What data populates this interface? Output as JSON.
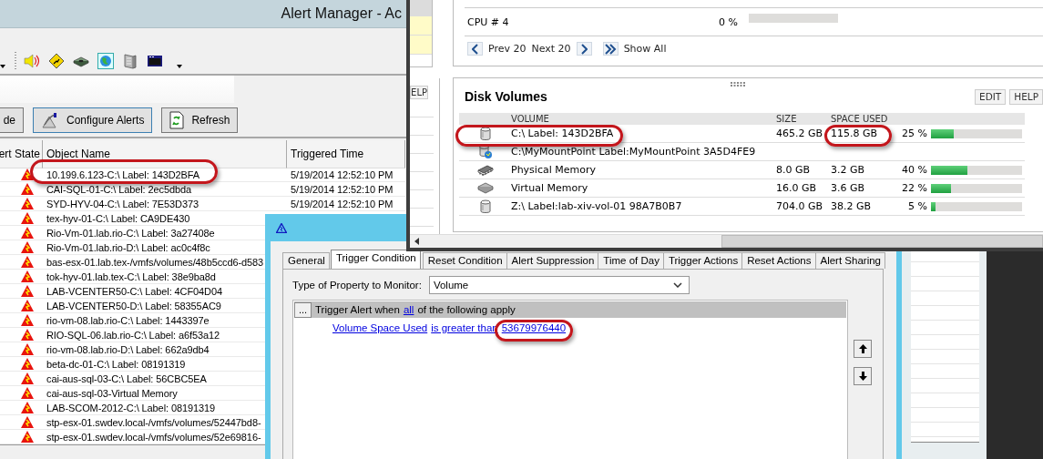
{
  "alert_manager": {
    "title": "Alert Manager - Ac",
    "buttons": [
      {
        "label": "de",
        "kind": "cut"
      },
      {
        "label": "Configure Alerts",
        "kind": "configure"
      },
      {
        "label": "Refresh",
        "kind": "refresh"
      }
    ],
    "table": {
      "columns": [
        "ert State",
        "Object Name",
        "Triggered Time"
      ],
      "rows": [
        {
          "object_name": "10.199.6.123-C:\\ Label: 143D2BFA",
          "triggered_time": "5/19/2014 12:52:10 PM"
        },
        {
          "object_name": "CAI-SQL-01-C:\\ Label: 2ec5dbda",
          "triggered_time": "5/19/2014 12:52:10 PM"
        },
        {
          "object_name": "SYD-HYV-04-C:\\ Label: 7E53D373",
          "triggered_time": "5/19/2014 12:52:10 PM"
        },
        {
          "object_name": "tex-hyv-01-C:\\ Label: CA9DE430"
        },
        {
          "object_name": "Rio-Vm-01.lab.rio-C:\\ Label: 3a27408e"
        },
        {
          "object_name": "Rio-Vm-01.lab.rio-D:\\ Label: ac0c4f8c"
        },
        {
          "object_name": "bas-esx-01.lab.tex-/vmfs/volumes/48b5ccd6-d583"
        },
        {
          "object_name": "tok-hyv-01.lab.tex-C:\\ Label: 38e9ba8d"
        },
        {
          "object_name": "LAB-VCENTER50-C:\\ Label: 4CF04D04"
        },
        {
          "object_name": "LAB-VCENTER50-D:\\ Label: 58355AC9"
        },
        {
          "object_name": "rio-vm-08.lab.rio-C:\\ Label: 1443397e"
        },
        {
          "object_name": "RIO-SQL-06.lab.rio-C:\\ Label: a6f53a12"
        },
        {
          "object_name": "rio-vm-08.lab.rio-D:\\ Label: 662a9db4"
        },
        {
          "object_name": "beta-dc-01-C:\\ Label: 08191319"
        },
        {
          "object_name": "cai-aus-sql-03-C:\\ Label: 56CBC5EA"
        },
        {
          "object_name": "cai-aus-sql-03-Virtual Memory"
        },
        {
          "object_name": "LAB-SCOM-2012-C:\\ Label: 08191319"
        },
        {
          "object_name": "stp-esx-01.swdev.local-/vmfs/volumes/52447bd8-"
        },
        {
          "object_name": "stp-esx-01.swdev.local-/vmfs/volumes/52e69816-"
        }
      ]
    }
  },
  "resource_page": {
    "side_button": "ELP",
    "cpu_row": {
      "name": "CPU # 4",
      "value": "0 %",
      "level": 0
    },
    "pager": {
      "prev": "Prev 20",
      "next": "Next 20",
      "show_all": "Show All"
    },
    "disk_volumes": {
      "title": "Disk Volumes",
      "buttons": [
        "EDIT",
        "HELP"
      ],
      "columns": [
        "VOLUME",
        "SIZE",
        "SPACE USED"
      ],
      "rows": [
        {
          "kind": "disk",
          "volume": "C:\\ Label: 143D2BFA",
          "size": "465.2 GB",
          "space_used": "115.8 GB",
          "percent": "25 %",
          "level": 0.25
        },
        {
          "kind": "mount",
          "volume": "C:\\MyMountPoint Label:MyMountPoint 3A5D4FE9"
        },
        {
          "kind": "memory",
          "volume": "Physical Memory",
          "size": "8.0 GB",
          "space_used": "3.2 GB",
          "percent": "40 %",
          "level": 0.4
        },
        {
          "kind": "virtual",
          "volume": "Virtual Memory",
          "size": "16.0 GB",
          "space_used": "3.6 GB",
          "percent": "22 %",
          "level": 0.22
        },
        {
          "kind": "disk",
          "volume": "Z:\\ Label:lab-xiv-vol-01 98A7B0B7",
          "size": "704.0 GB",
          "space_used": "38.2 GB",
          "percent": "5 %",
          "level": 0.05
        }
      ]
    }
  },
  "dialog": {
    "tabs": [
      {
        "label": "General",
        "selected": false
      },
      {
        "label": "Trigger Condition",
        "selected": true
      },
      {
        "label": "Reset Condition",
        "selected": false
      },
      {
        "label": "Alert Suppression",
        "selected": false
      },
      {
        "label": "Time of Day",
        "selected": false
      },
      {
        "label": "Trigger Actions",
        "selected": false
      },
      {
        "label": "Reset Actions",
        "selected": false
      },
      {
        "label": "Alert Sharing",
        "selected": false
      }
    ],
    "property_label": "Type of Property to Monitor:",
    "property_value": "Volume",
    "condition": {
      "menu_button": "...",
      "header_before": "Trigger Alert when",
      "header_link": "all",
      "header_after": "of the following apply",
      "links": [
        "Volume Space Used",
        "is greater than",
        "53679976440"
      ]
    }
  }
}
